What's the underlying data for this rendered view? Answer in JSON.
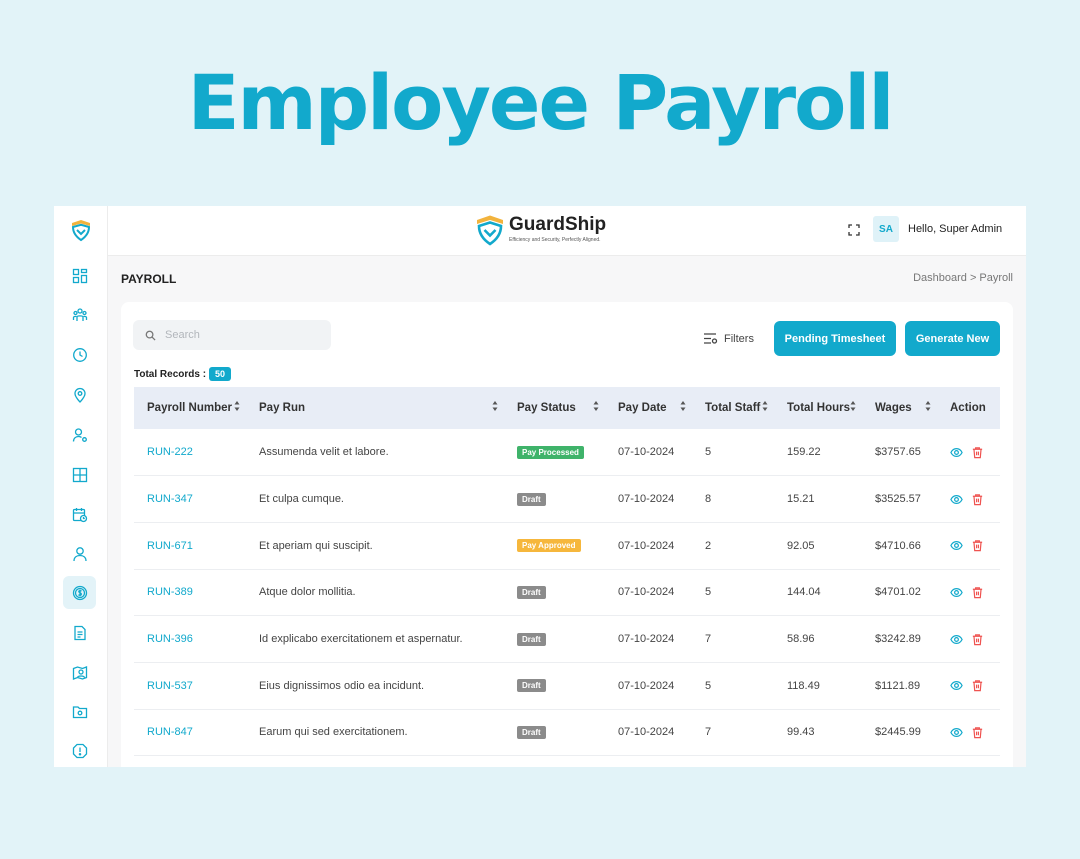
{
  "hero": {
    "title": "Employee Payroll"
  },
  "brand": {
    "name": "GuardShip",
    "tagline": "Efficiency and Security, Perfectly Aligned."
  },
  "header": {
    "avatar_initials": "SA",
    "greeting": "Hello, Super Admin"
  },
  "page": {
    "title": "PAYROLL",
    "breadcrumb": [
      "Dashboard",
      "Payroll"
    ],
    "breadcrumb_separator": ">"
  },
  "toolbar": {
    "search_placeholder": "Search",
    "filters_label": "Filters",
    "pending_label": "Pending Timesheet",
    "generate_label": "Generate New"
  },
  "records": {
    "label": "Total Records :",
    "count": "50"
  },
  "table": {
    "columns": [
      "Payroll Number",
      "Pay Run",
      "Pay Status",
      "Pay Date",
      "Total Staff",
      "Total Hours",
      "Wages",
      "Action"
    ],
    "rows": [
      {
        "number": "RUN-222",
        "run": "Assumenda velit et labore.",
        "status": "Pay Processed",
        "status_type": "processed",
        "date": "07-10-2024",
        "staff": "5",
        "hours": "159.22",
        "wages": "$3757.65"
      },
      {
        "number": "RUN-347",
        "run": "Et culpa cumque.",
        "status": "Draft",
        "status_type": "draft",
        "date": "07-10-2024",
        "staff": "8",
        "hours": "15.21",
        "wages": "$3525.57"
      },
      {
        "number": "RUN-671",
        "run": "Et aperiam qui suscipit.",
        "status": "Pay Approved",
        "status_type": "approved",
        "date": "07-10-2024",
        "staff": "2",
        "hours": "92.05",
        "wages": "$4710.66"
      },
      {
        "number": "RUN-389",
        "run": "Atque dolor mollitia.",
        "status": "Draft",
        "status_type": "draft",
        "date": "07-10-2024",
        "staff": "5",
        "hours": "144.04",
        "wages": "$4701.02"
      },
      {
        "number": "RUN-396",
        "run": "Id explicabo exercitationem et aspernatur.",
        "status": "Draft",
        "status_type": "draft",
        "date": "07-10-2024",
        "staff": "7",
        "hours": "58.96",
        "wages": "$3242.89"
      },
      {
        "number": "RUN-537",
        "run": "Eius dignissimos odio ea incidunt.",
        "status": "Draft",
        "status_type": "draft",
        "date": "07-10-2024",
        "staff": "5",
        "hours": "118.49",
        "wages": "$1121.89"
      },
      {
        "number": "RUN-847",
        "run": "Earum qui sed exercitationem.",
        "status": "Draft",
        "status_type": "draft",
        "date": "07-10-2024",
        "staff": "7",
        "hours": "99.43",
        "wages": "$2445.99"
      }
    ]
  },
  "sidebar": {
    "active": "payroll",
    "items": [
      "dashboard-icon",
      "team-icon",
      "clock-icon",
      "location-icon",
      "user-settings-icon",
      "layout-icon",
      "calendar-icon",
      "user-icon",
      "dollar-icon",
      "document-icon",
      "map-icon",
      "folder-icon",
      "alert-icon"
    ]
  },
  "colors": {
    "accent": "#12a9cc",
    "processed": "#3fb36a",
    "draft": "#8b8b8b",
    "approved": "#f6b73c",
    "brand_gold": "#f2b33d",
    "danger": "#ef5350"
  }
}
